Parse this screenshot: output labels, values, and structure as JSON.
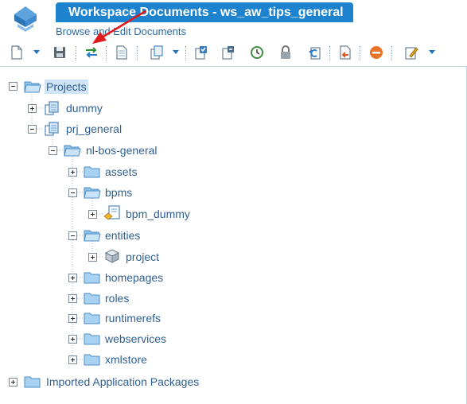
{
  "header": {
    "title": "Workspace Documents - ws_aw_tips_general",
    "subtitle": "Browse and Edit Documents"
  },
  "toolbar": {
    "buttons": [
      {
        "icon": "new-document-icon"
      },
      {
        "icon": "save-icon"
      },
      {
        "icon": "synchronize-icon"
      },
      {
        "icon": "properties-icon"
      },
      {
        "icon": "copy-icon"
      },
      {
        "icon": "checkin-icon"
      },
      {
        "icon": "checkout-icon"
      },
      {
        "icon": "history-icon"
      },
      {
        "icon": "lock-icon"
      },
      {
        "icon": "revert-icon"
      },
      {
        "icon": "export-icon"
      },
      {
        "icon": "delete-icon"
      },
      {
        "icon": "edit-icon"
      }
    ]
  },
  "tree": {
    "root": "Projects",
    "projects": [
      {
        "label": "dummy"
      },
      {
        "label": "prj_general"
      }
    ],
    "folder": "nl-bos-general",
    "children": [
      {
        "label": "assets"
      },
      {
        "label": "bpms"
      },
      {
        "label": "bpm_dummy"
      },
      {
        "label": "entities"
      },
      {
        "label": "project"
      },
      {
        "label": "homepages"
      },
      {
        "label": "roles"
      },
      {
        "label": "runtimerefs"
      },
      {
        "label": "webservices"
      },
      {
        "label": "xmlstore"
      }
    ],
    "imported": "Imported Application Packages"
  },
  "colors": {
    "title_bar": "#1d83cf",
    "link_text": "#2f5f92",
    "annotation_arrow": "#e01b1b",
    "selection": "#cfe4f7"
  }
}
